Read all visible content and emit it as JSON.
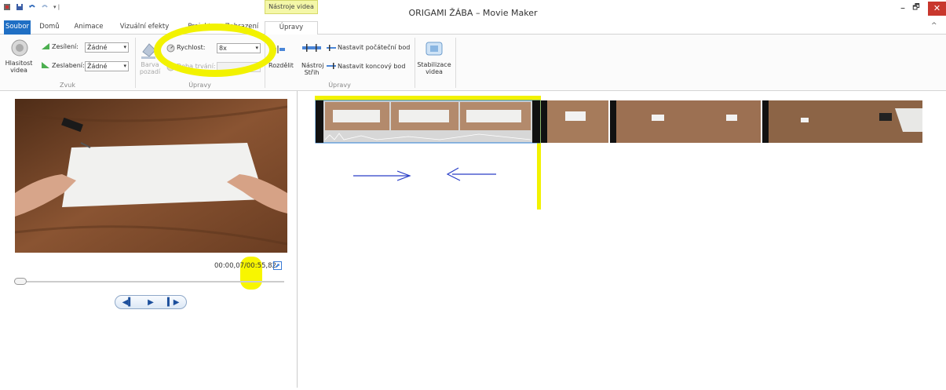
{
  "titlebar": {
    "context_tab": "Nástroje videa",
    "app_title": "ORIGAMI ŽÁBA – Movie Maker",
    "minimize": "–",
    "restore": "🗗",
    "close": "✕"
  },
  "tabs": {
    "soubor": "Soubor",
    "domu": "Domů",
    "animace": "Animace",
    "vizualni": "Vizuální efekty",
    "projekt": "Projekt",
    "zobrazeni": "Zobrazení",
    "upravy": "Úpravy",
    "collapse": "^"
  },
  "ribbon": {
    "sound": {
      "volume_label": "Hlasitost videa",
      "fade_in_label": "Zesílení:",
      "fade_in_value": "Žádné",
      "fade_out_label": "Zeslabení:",
      "fade_out_value": "Žádné",
      "group_label": "Zvuk"
    },
    "adjust": {
      "bg_color_label": "Barva pozadí",
      "speed_label": "Rychlost:",
      "speed_value": "8x",
      "duration_label": "Doba trvání:",
      "duration_value": "",
      "group_label": "Úpravy"
    },
    "edit": {
      "split_label": "Rozdělit",
      "trim_label": "Nástroj Střih",
      "set_start_label": "Nastavit počáteční bod",
      "set_end_label": "Nastavit koncový bod",
      "stabilize_label": "Stabilizace videa",
      "group_label": "Úpravy"
    }
  },
  "preview": {
    "time_current": "00:00,07",
    "time_total": "00:55,82",
    "progress": 0.001
  },
  "colors": {
    "highlight": "#f2f200",
    "arrow": "#2a3fc8",
    "tab_accent": "#1f6fc4",
    "close_red": "#c8372d"
  }
}
